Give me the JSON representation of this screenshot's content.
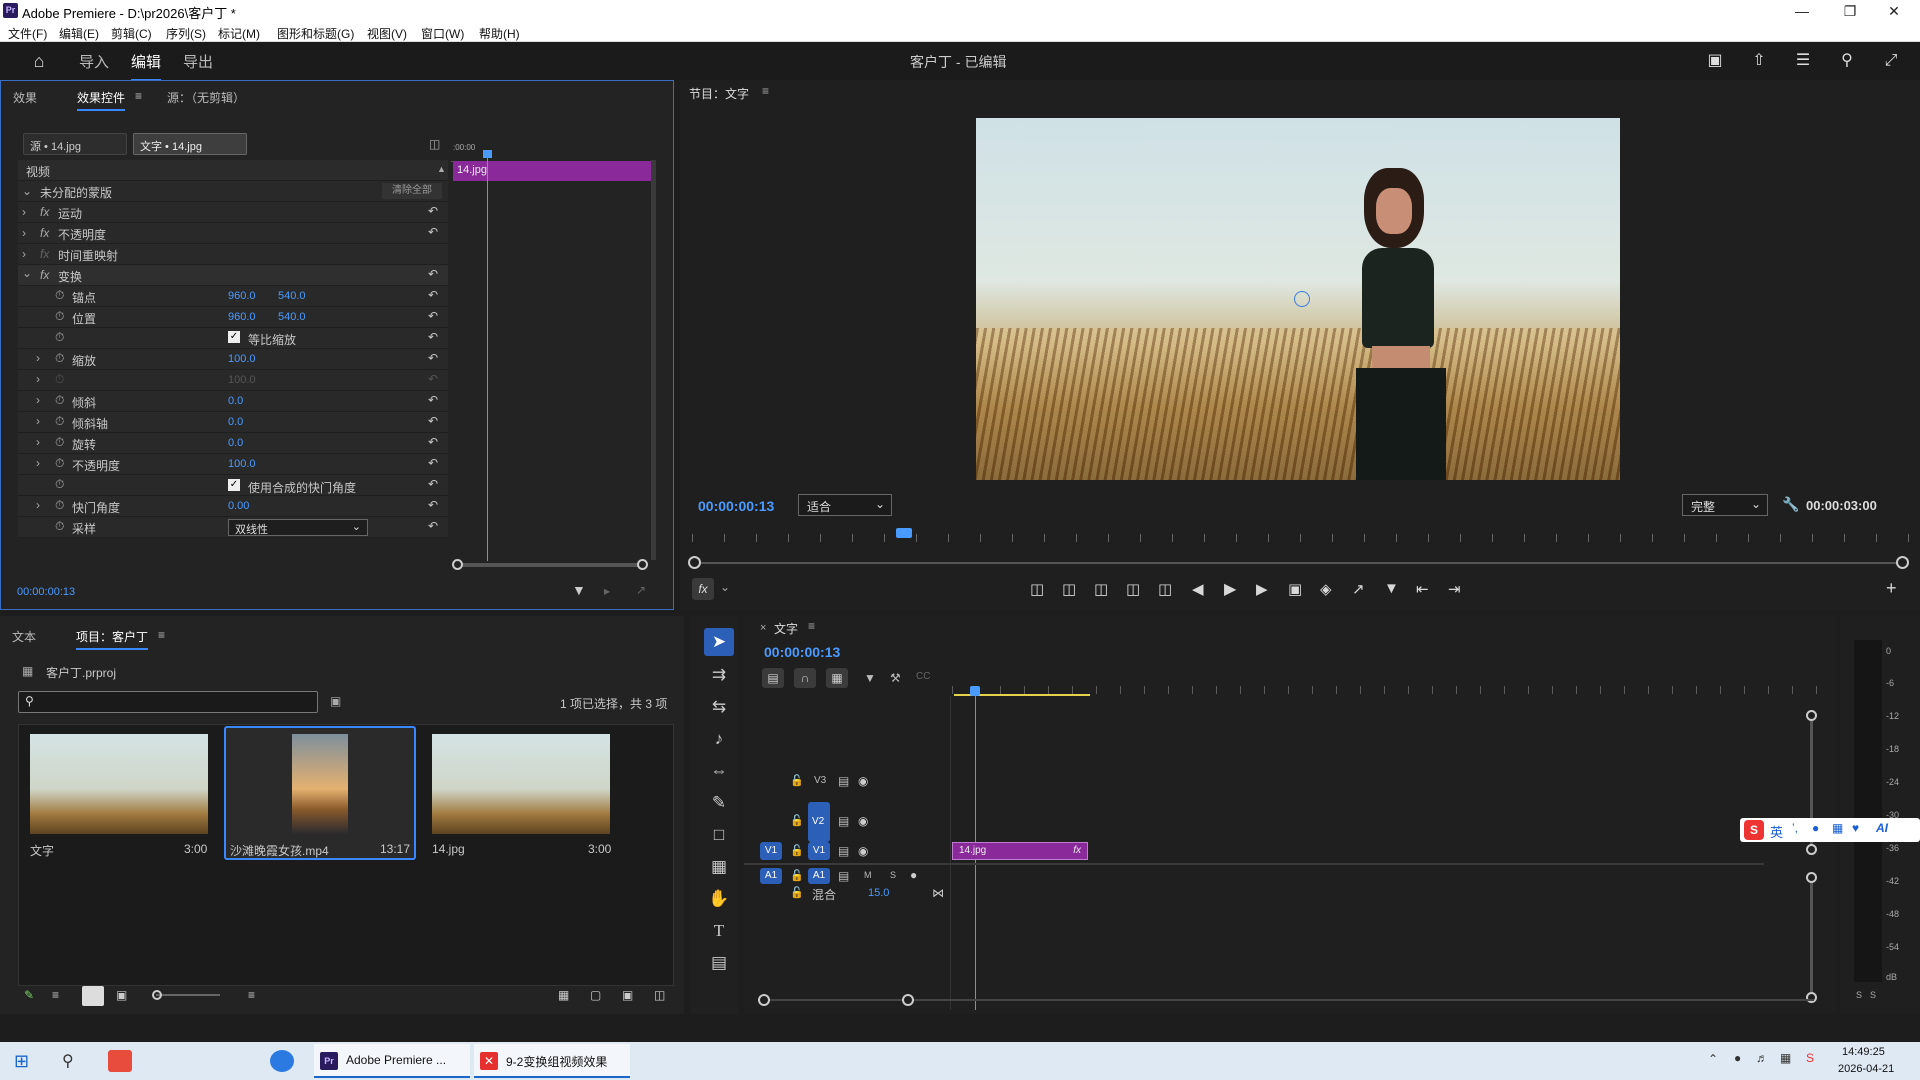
{
  "window": {
    "title": "Adobe Premiere - D:\\pr2026\\客户丁 *",
    "app_icon": "Pr",
    "controls": [
      "minimize-icon",
      "maximize-icon",
      "close-icon"
    ]
  },
  "menu": [
    "文件(F)",
    "编辑(E)",
    "剪辑(C)",
    "序列(S)",
    "标记(M)",
    "图形和标题(G)",
    "视图(V)",
    "窗口(W)",
    "帮助(H)"
  ],
  "header": {
    "nav": [
      "导入",
      "编辑",
      "导出"
    ],
    "active_nav": "编辑",
    "project_title": "客户丁 - 已编辑"
  },
  "effect_controls": {
    "tabs": [
      "效果",
      "效果控件",
      "源：（无剪辑）"
    ],
    "source_chip": "源 • 14.jpg",
    "target_chip": "文字 • 14.jpg",
    "ruler_start": ":00:00",
    "clip_label": "14.jpg",
    "section_video": "视频",
    "mask_label": "未分配的蒙版",
    "clear_all": "清除全部",
    "rows": [
      {
        "name": "运动"
      },
      {
        "name": "不透明度"
      },
      {
        "name": "时间重映射"
      },
      {
        "name": "变换"
      }
    ],
    "transform": {
      "anchor_label": "锚点",
      "anchor_x": "960.0",
      "anchor_y": "540.0",
      "position_label": "位置",
      "position_x": "960.0",
      "position_y": "540.0",
      "uniform_scale": "等比缩放",
      "scale_label": "缩放",
      "scale": "100.0",
      "scale_w": "100.0",
      "skew_label": "倾斜",
      "skew": "0.0",
      "skew_axis_label": "倾斜轴",
      "skew_axis": "0.0",
      "rotation_label": "旋转",
      "rotation": "0.0",
      "opacity_label": "不透明度",
      "opacity": "100.0",
      "comp_shutter": "使用合成的快门角度",
      "shutter_label": "快门角度",
      "shutter": "0.00",
      "sampling_label": "采样",
      "sampling": "双线性"
    },
    "timecode": "00:00:00:13"
  },
  "program_monitor": {
    "title": "节目：文字",
    "timecode": "00:00:00:13",
    "fit": "适合",
    "quality": "完整",
    "duration": "00:00:03:00"
  },
  "project": {
    "tabs": [
      "文本",
      "项目：客户丁"
    ],
    "file": "客户丁.prproj",
    "search_placeholder": "",
    "selection": "1 项已选择，共 3 项",
    "items": [
      {
        "name": "文字",
        "duration": "3:00"
      },
      {
        "name": "沙滩晚霞女孩.mp4",
        "duration": "13:17"
      },
      {
        "name": "14.jpg",
        "duration": "3:00"
      }
    ]
  },
  "timeline": {
    "tab": "文字",
    "timecode": "00:00:00:13",
    "tracks": [
      "V3",
      "V2",
      "V1",
      "A1"
    ],
    "clip": "14.jpg",
    "mix_label": "混合",
    "mix_value": "15.0",
    "meter_labels": [
      "0",
      "-6",
      "-12",
      "-18",
      "-24",
      "-30",
      "-36",
      "-42",
      "-48",
      "-54",
      "dB"
    ],
    "solo": [
      "S",
      "S"
    ],
    "audio_buttons": [
      "M",
      "S"
    ]
  },
  "ime": {
    "lang": "英"
  },
  "taskbar": {
    "apps": [
      "Adobe Premiere ...",
      "9-2变换组视频效果"
    ],
    "time": "14:49:25",
    "date": "2026-04-21"
  }
}
